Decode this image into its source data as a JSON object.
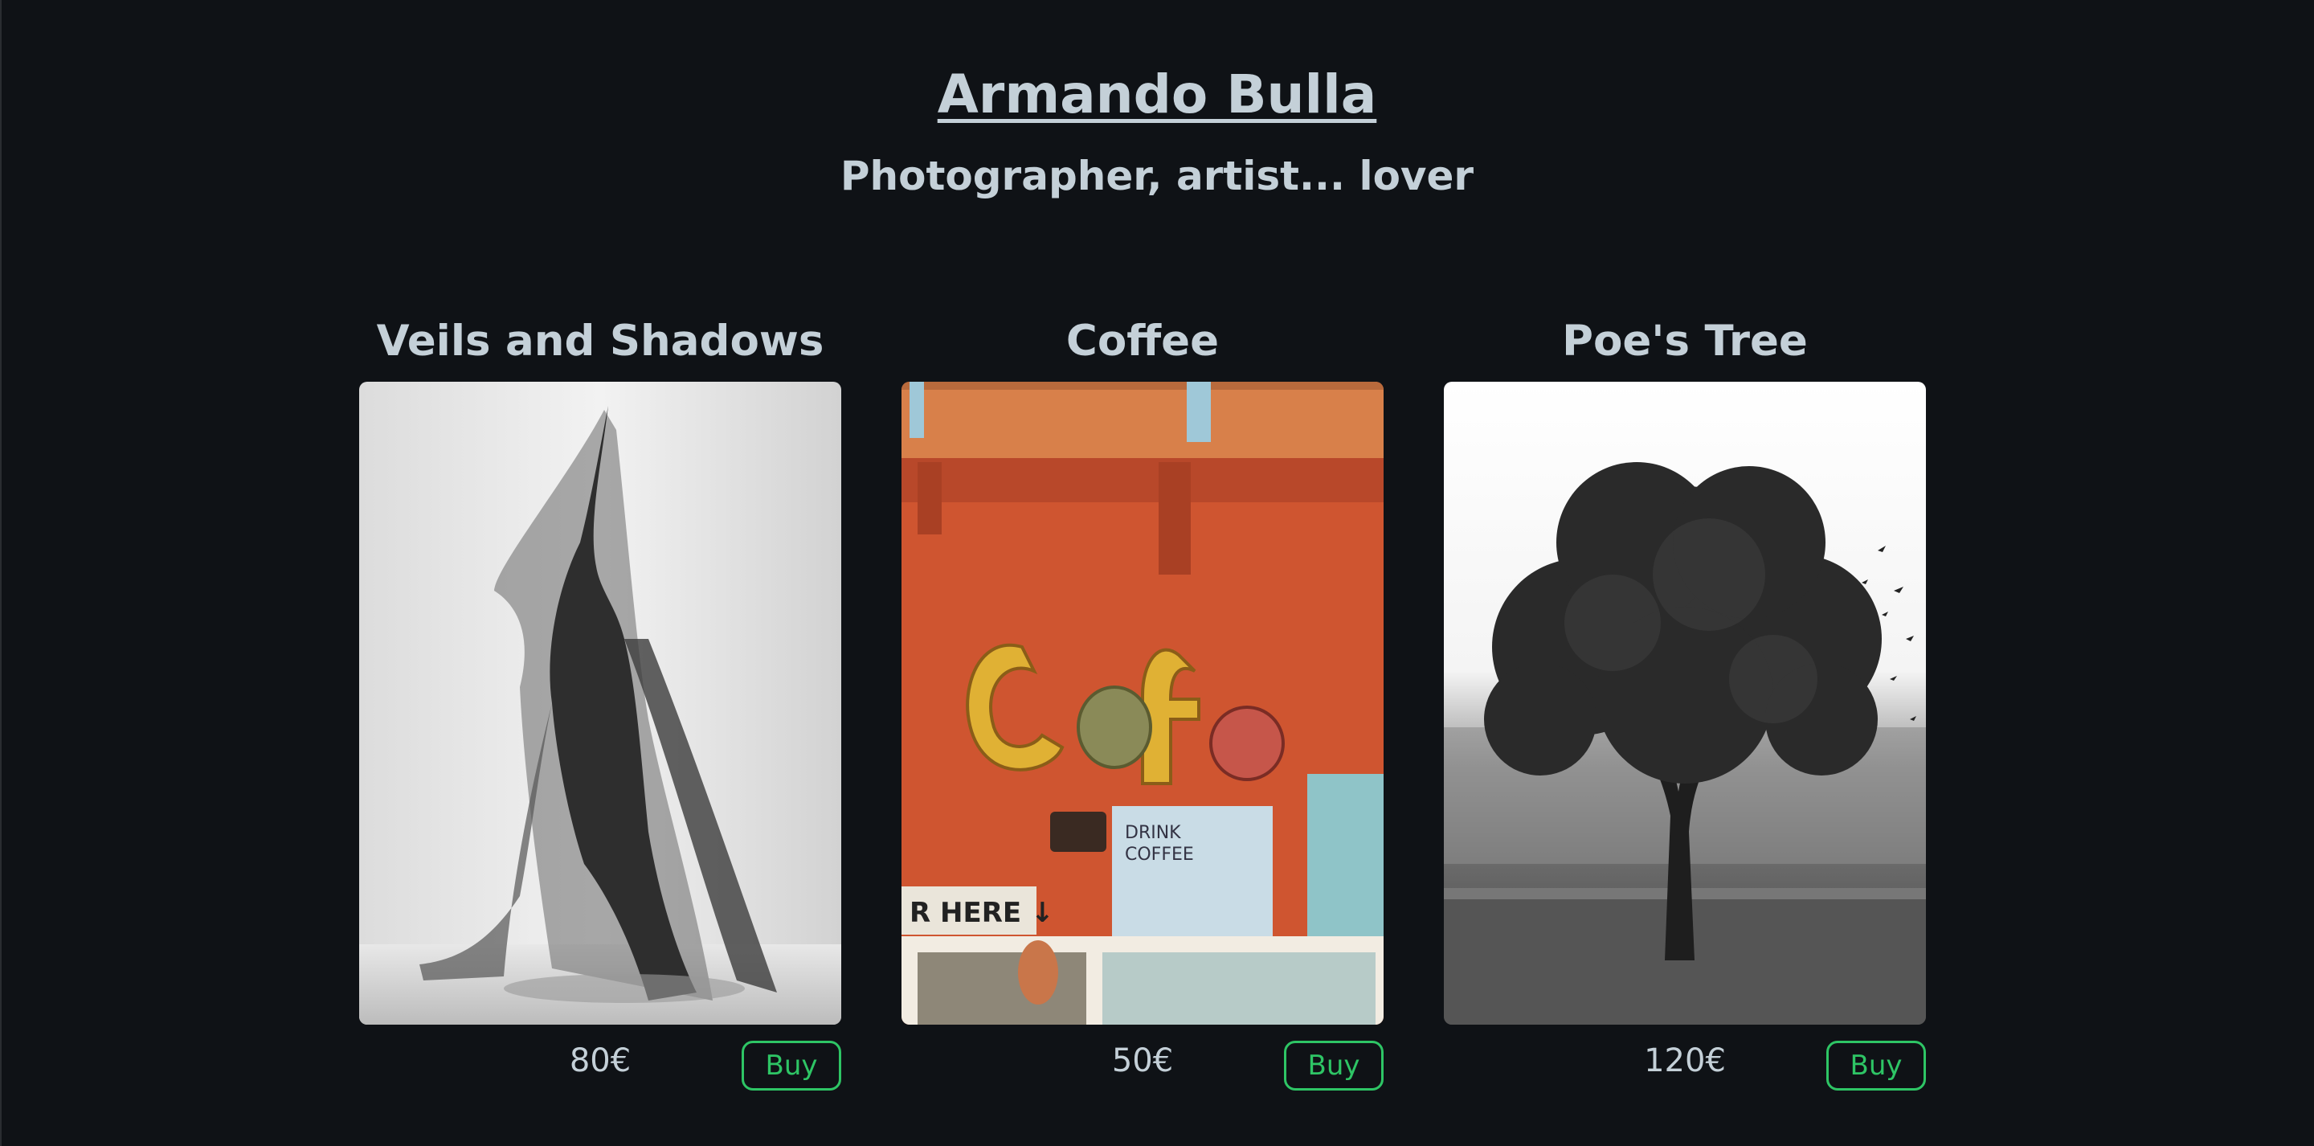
{
  "header": {
    "title": "Armando Bulla",
    "tagline": "Photographer, artist... lover"
  },
  "products": [
    {
      "title": "Veils and Shadows",
      "price": "80€",
      "buy_label": "Buy",
      "image": "veiled-dancer-photo"
    },
    {
      "title": "Coffee",
      "price": "50€",
      "buy_label": "Buy",
      "image": "cafe-sign-photo"
    },
    {
      "title": "Poe's Tree",
      "price": "120€",
      "buy_label": "Buy",
      "image": "lone-tree-photo"
    }
  ],
  "colors": {
    "background": "#0f1216",
    "text": "#c4d0d8",
    "accent": "#2ec565"
  }
}
